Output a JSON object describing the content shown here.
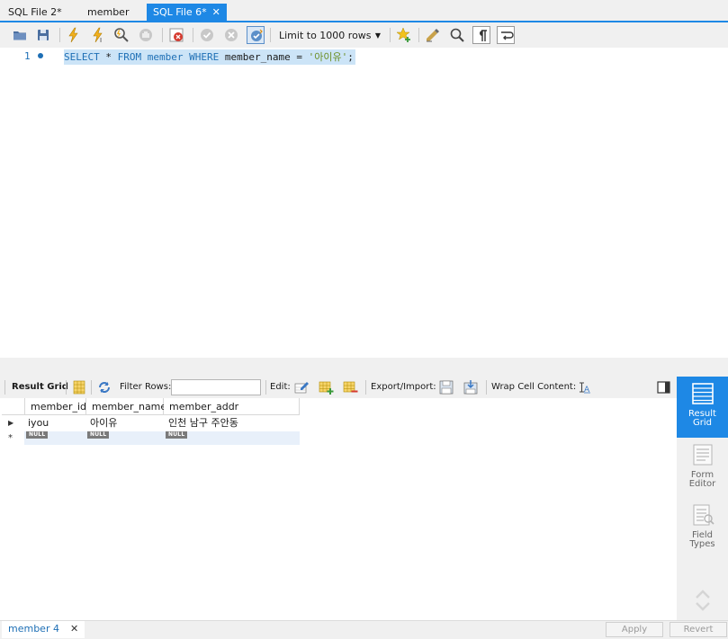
{
  "tabs": [
    {
      "label": "SQL File 2*",
      "active": false
    },
    {
      "label": "member",
      "active": false
    },
    {
      "label": "SQL File 6*",
      "active": true,
      "close": "✕"
    }
  ],
  "toolbar": {
    "limit_select": "Limit to 1000 rows",
    "icons": [
      "open-folder-icon",
      "save-icon",
      "execute-icon",
      "execute-current-icon",
      "explain-icon",
      "stop-icon",
      "toggle-error-icon",
      "commit-icon",
      "rollback-icon",
      "autocommit-icon",
      "bookmark-add-icon",
      "beautify-icon",
      "find-icon",
      "invisibles-icon",
      "wrap-icon"
    ]
  },
  "editor": {
    "line_number": "1",
    "tokens": [
      {
        "t": "SELECT",
        "k": "kw"
      },
      {
        "t": " * ",
        "k": "plain"
      },
      {
        "t": "FROM",
        "k": "kw"
      },
      {
        "t": " ",
        "k": "plain"
      },
      {
        "t": "member",
        "k": "kw"
      },
      {
        "t": " ",
        "k": "plain"
      },
      {
        "t": "WHERE",
        "k": "kw"
      },
      {
        "t": " member_name = ",
        "k": "plain"
      },
      {
        "t": "'아이유'",
        "k": "str"
      },
      {
        "t": ";",
        "k": "plain"
      }
    ]
  },
  "result_toolbar": {
    "result_grid_label": "Result Grid",
    "filter_rows_label": "Filter Rows:",
    "filter_value": "",
    "edit_label": "Edit:",
    "export_import_label": "Export/Import:",
    "wrap_label": "Wrap Cell Content:"
  },
  "grid": {
    "columns": [
      "member_id",
      "member_name",
      "member_addr"
    ],
    "rows": [
      [
        "iyou",
        "아이유",
        "인천 남구 주안동"
      ]
    ],
    "new_row_marker": "*",
    "null_label": "NULL"
  },
  "side_panel": [
    {
      "label_1": "Result",
      "label_2": "Grid",
      "active": true
    },
    {
      "label_1": "Form",
      "label_2": "Editor",
      "active": false
    },
    {
      "label_1": "Field",
      "label_2": "Types",
      "active": false
    }
  ],
  "bottom": {
    "result_tab": "member 4",
    "close": "✕",
    "apply_label": "Apply",
    "revert_label": "Revert"
  },
  "colors": {
    "accent": "#1e88e5",
    "keyword": "#1e6fb5",
    "string": "#6b8e23",
    "selection": "#cce4f7"
  }
}
